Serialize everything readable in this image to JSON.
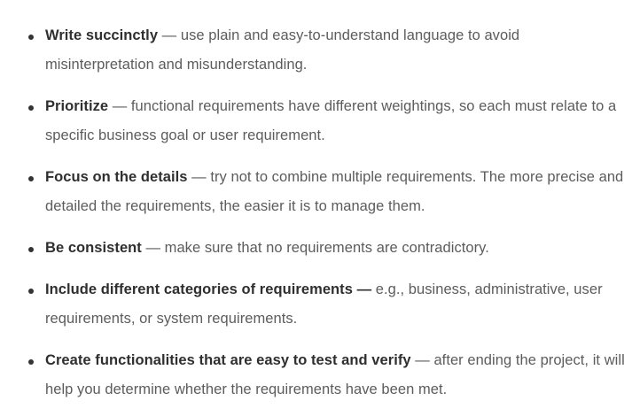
{
  "items": [
    {
      "term": "Write succinctly",
      "desc": " — use plain and easy-to-understand language to avoid misinterpretation and misunderstanding."
    },
    {
      "term": "Prioritize",
      "desc": " — functional requirements have different weightings, so each must relate to a specific business goal or user requirement."
    },
    {
      "term": "Focus on the details",
      "desc": " — try not to combine multiple requirements. The more precise and detailed the requirements, the easier it is to manage them."
    },
    {
      "term": "Be consistent",
      "desc": " — make sure that no requirements are contradictory."
    },
    {
      "term": "Include different categories of requirements —",
      "desc": " e.g., business, administrative, user requirements, or system requirements."
    },
    {
      "term": "Create functionalities that are easy to test and verify",
      "desc": " — after ending the project, it will help you determine whether the requirements have been met."
    }
  ]
}
